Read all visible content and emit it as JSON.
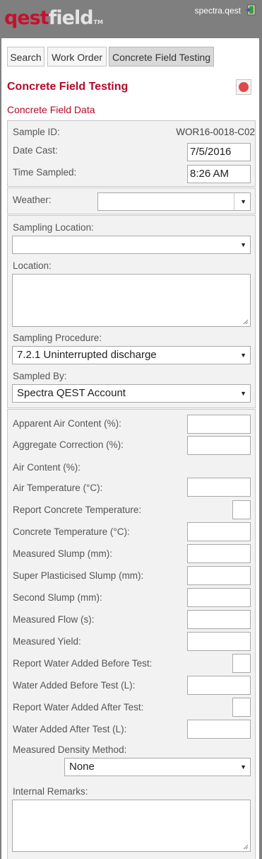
{
  "header": {
    "logo_part1": "qest",
    "logo_part2": "field",
    "logo_tm": "TM",
    "user": "spectra.qest"
  },
  "tabs": [
    {
      "label": "Search"
    },
    {
      "label": "Work Order"
    },
    {
      "label": "Concrete Field Testing"
    }
  ],
  "page_title": "Concrete Field Testing",
  "section_title": "Concrete Field Data",
  "sample": {
    "sample_id_label": "Sample ID:",
    "sample_id_value": "WOR16-0018-C02",
    "date_cast_label": "Date Cast:",
    "date_cast_value": "7/5/2016",
    "time_sampled_label": "Time Sampled:",
    "time_sampled_value": "8:26 AM"
  },
  "weather": {
    "label": "Weather:",
    "value": ""
  },
  "sampling": {
    "location_label": "Sampling Location:",
    "location_value": "",
    "location2_label": "Location:",
    "location2_value": "",
    "procedure_label": "Sampling Procedure:",
    "procedure_value": "7.2.1 Uninterrupted discharge",
    "sampled_by_label": "Sampled By:",
    "sampled_by_value": "Spectra QEST Account"
  },
  "tests": {
    "apparent_air": "Apparent Air Content (%):",
    "aggregate_correction": "Aggregate Correction (%):",
    "air_content": "Air Content (%):",
    "air_temperature": "Air Temperature (°C):",
    "report_concrete_temp": "Report Concrete Temperature:",
    "concrete_temp": "Concrete Temperature (°C):",
    "measured_slump": "Measured Slump (mm):",
    "super_plasticised_slump": "Super Plasticised Slump (mm):",
    "second_slump": "Second Slump (mm):",
    "measured_flow": "Measured Flow (s):",
    "measured_yield": "Measured Yield:",
    "report_water_before": "Report Water Added Before Test:",
    "water_before": "Water Added Before Test (L):",
    "report_water_after": "Report Water Added After Test:",
    "water_after": "Water Added After Test (L):",
    "density_method_label": "Measured Density Method:",
    "density_method_value": "None",
    "remarks_label": "Internal Remarks:",
    "remarks_value": ""
  },
  "colors": {
    "accent": "#b5082a",
    "header_bg": "#7f7f7f",
    "fieldset_bg": "#f2f2f2"
  },
  "icons": {
    "logout": "logout-door-icon",
    "remove": "remove-circle-icon",
    "dropdown": "chevron-down-icon",
    "resize": "resize-grip-icon"
  }
}
